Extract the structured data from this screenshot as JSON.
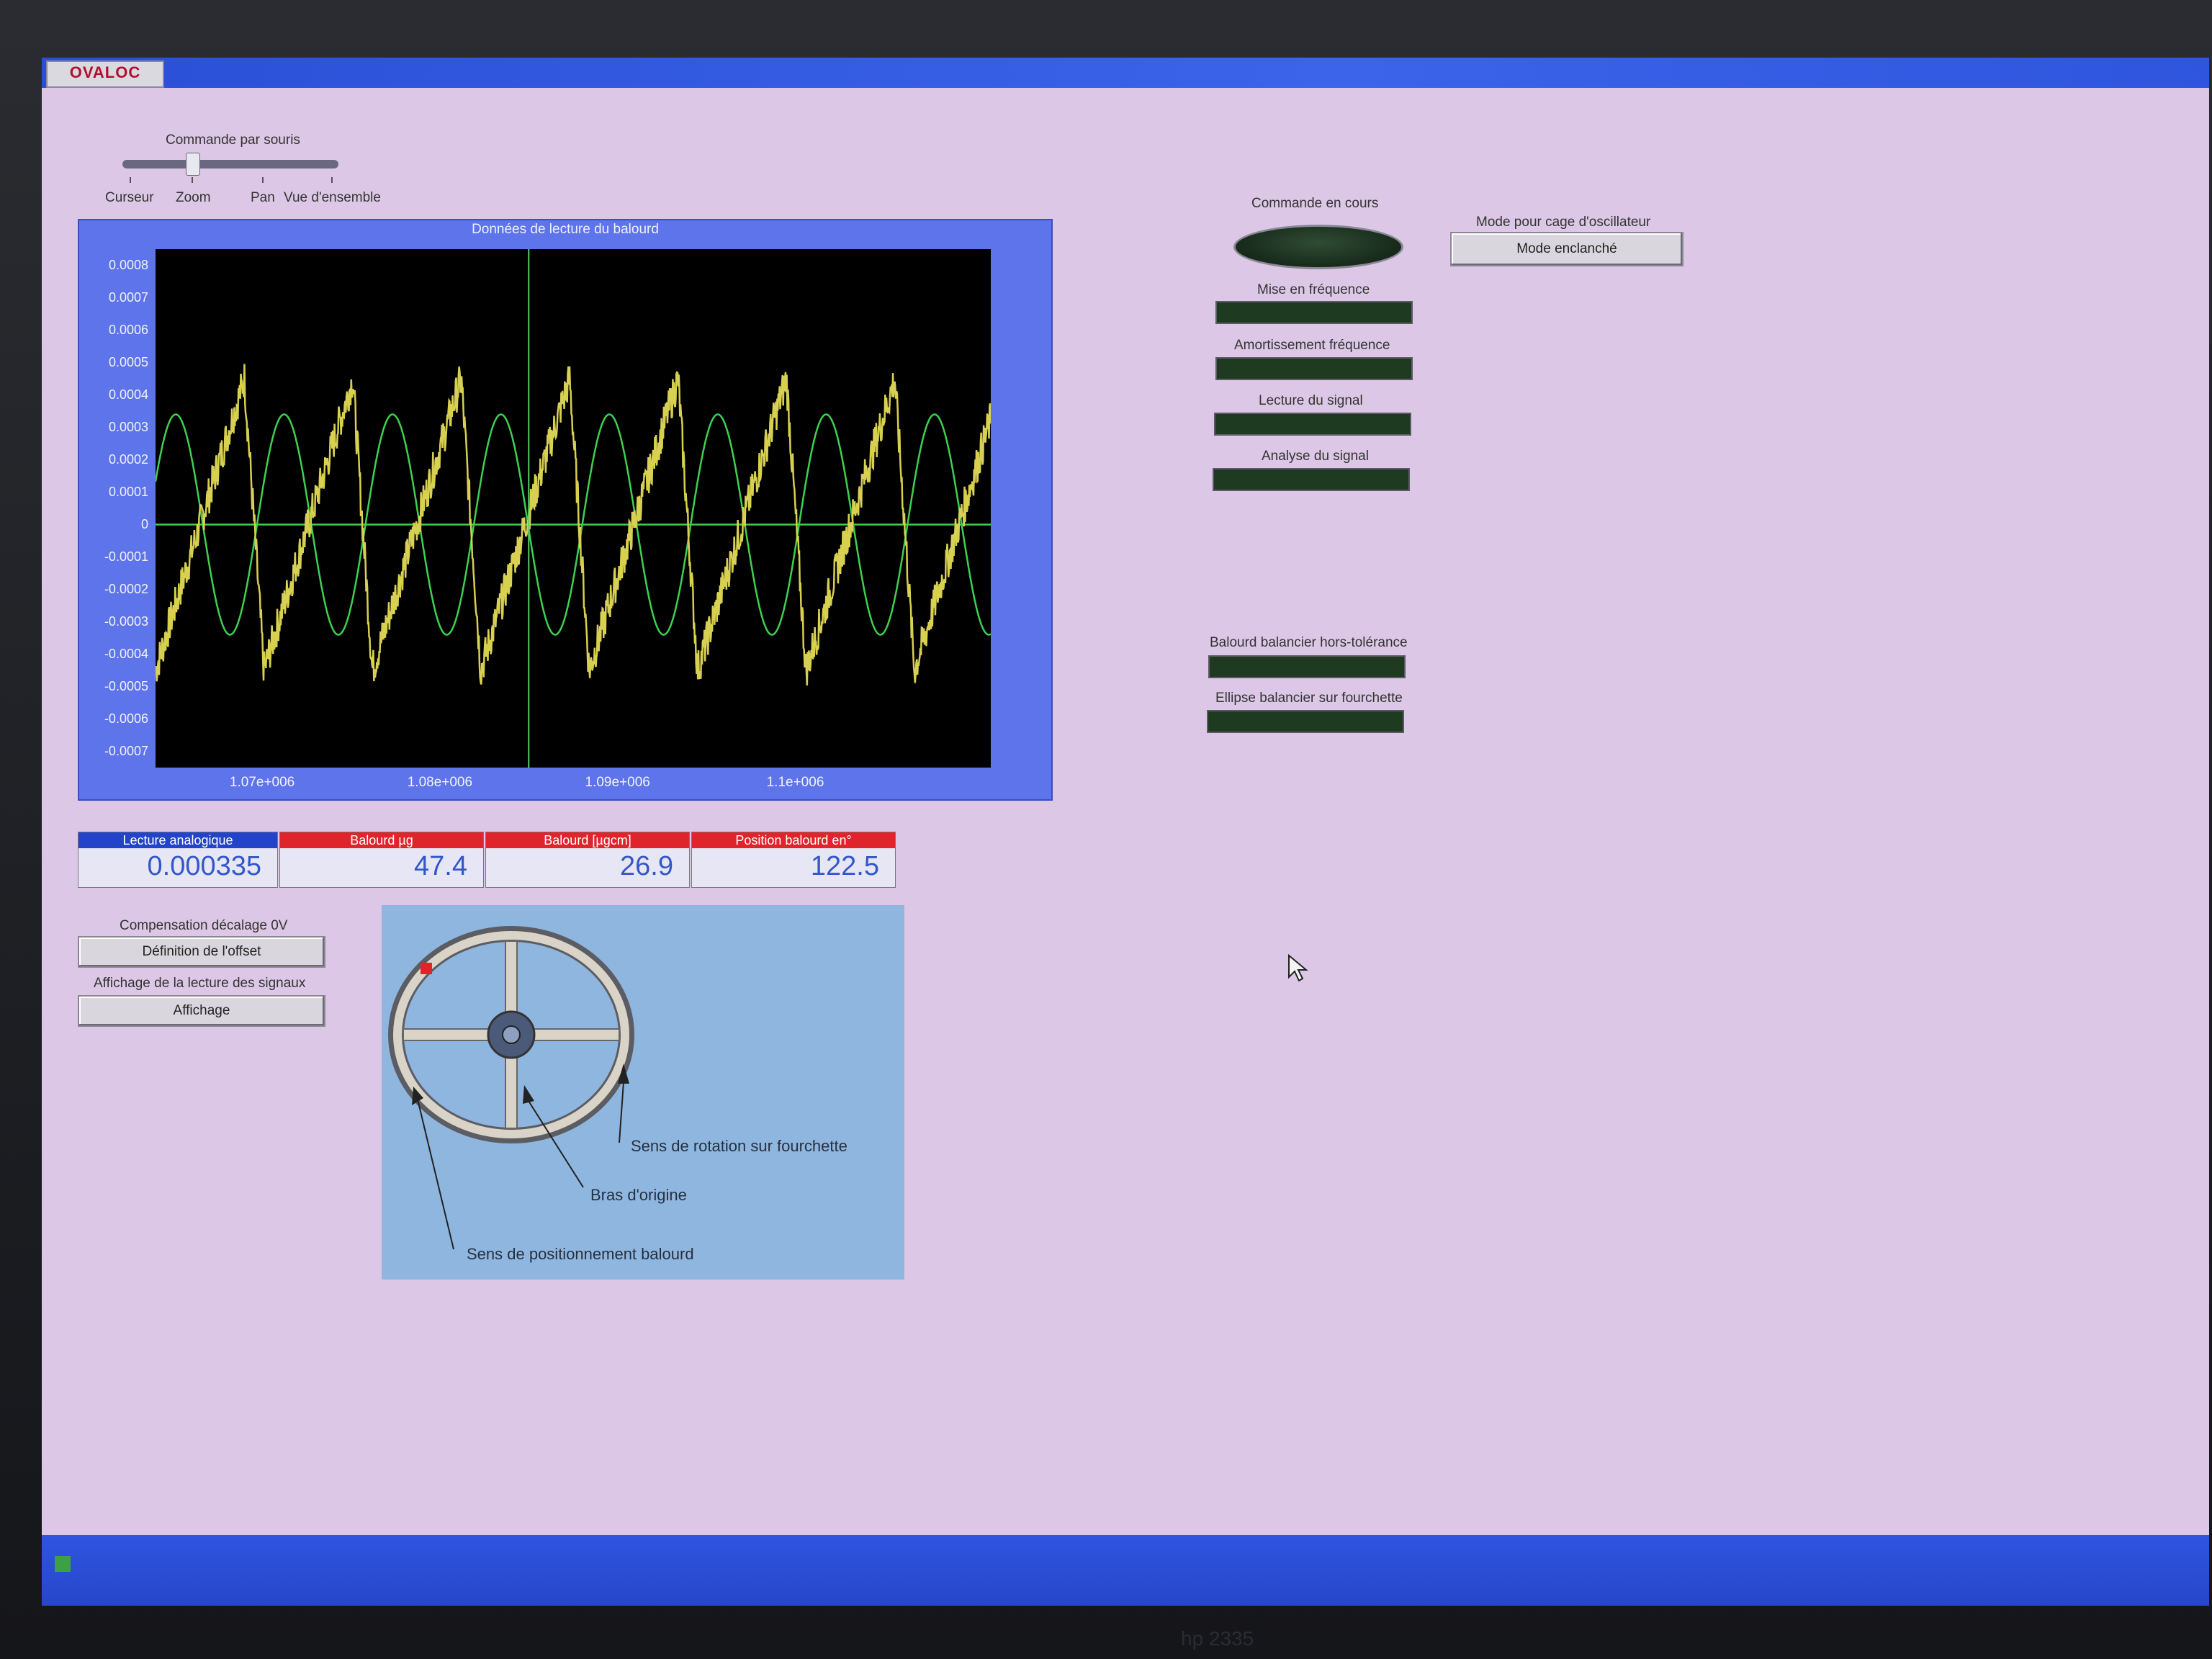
{
  "app": {
    "logo_text": "OVALOC"
  },
  "mouse_command": {
    "title": "Commande par souris",
    "options": [
      "Curseur",
      "Zoom",
      "Pan",
      "Vue d'ensemble"
    ],
    "selected": "Zoom"
  },
  "graph": {
    "title": "Données de lecture du balourd",
    "y_ticks": [
      "0.0008",
      "0.0007",
      "0.0006",
      "0.0005",
      "0.0004",
      "0.0003",
      "0.0002",
      "0.0001",
      "0",
      "-0.0001",
      "-0.0002",
      "-0.0003",
      "-0.0004",
      "-0.0005",
      "-0.0006",
      "-0.0007"
    ],
    "x_ticks": [
      "1.07e+006",
      "1.08e+006",
      "1.09e+006",
      "1.1e+006"
    ]
  },
  "chart_data": {
    "type": "line",
    "title": "Données de lecture du balourd",
    "xlabel": "",
    "ylabel": "",
    "xlim": [
      1064000,
      1111000
    ],
    "ylim": [
      -0.00075,
      0.00085
    ],
    "x_ticks": [
      1070000,
      1080000,
      1090000,
      1100000
    ],
    "y_ticks": [
      0.0008,
      0.0007,
      0.0006,
      0.0005,
      0.0004,
      0.0003,
      0.0002,
      0.0001,
      0,
      -0.0001,
      -0.0002,
      -0.0003,
      -0.0004,
      -0.0005,
      -0.0006,
      -0.0007
    ],
    "series": [
      {
        "color": "#d8d050",
        "style": "noisy sawtooth",
        "amplitude": 0.00045,
        "period": 6100
      },
      {
        "color": "#3ed050",
        "style": "sine",
        "amplitude": 0.00034,
        "period": 6100
      },
      {
        "color": "#3ed050",
        "style": "flat",
        "value": 0
      }
    ],
    "cursor_x": 1085000,
    "grid": false
  },
  "indicators": [
    {
      "label": "Lecture analogique",
      "value": "0.000335",
      "header_color": "#2344c8"
    },
    {
      "label": "Balourd µg",
      "value": "47.4",
      "header_color": "#e0242c"
    },
    {
      "label": "Balourd [µgcm]",
      "value": "26.9",
      "header_color": "#e0242c"
    },
    {
      "label": "Position balourd en°",
      "value": "122.5",
      "header_color": "#e0242c"
    }
  ],
  "offset": {
    "label": "Compensation décalage 0V",
    "button": "Définition de l'offset"
  },
  "display": {
    "label": "Affichage de la lecture des signaux",
    "button": "Affichage"
  },
  "status": {
    "command_label": "Commande en cours",
    "leds": [
      {
        "label": "Mise en fréquence"
      },
      {
        "label": "Amortissement fréquence"
      },
      {
        "label": "Lecture du signal"
      },
      {
        "label": "Analyse du signal"
      }
    ],
    "alarms": [
      {
        "label": "Balourd balancier hors-tolérance"
      },
      {
        "label": "Ellipse balancier sur fourchette"
      }
    ]
  },
  "oscillator": {
    "label": "Mode pour cage d'oscillateur",
    "button": "Mode enclanché"
  },
  "diagram": {
    "labels": {
      "rotation": "Sens de rotation sur fourchette",
      "origin": "Bras d'origine",
      "positioning": "Sens de positionnement balourd"
    }
  },
  "monitor": {
    "brand": "hp 2335"
  }
}
